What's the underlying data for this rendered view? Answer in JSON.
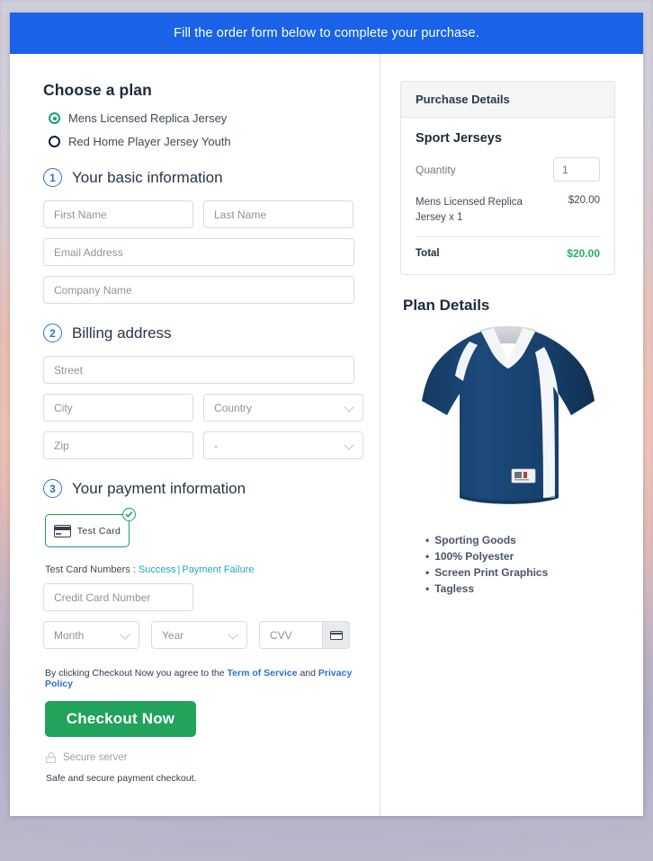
{
  "banner": {
    "text": "Fill the order form below to complete your purchase."
  },
  "plan": {
    "title": "Choose a plan",
    "options": [
      {
        "label": "Mens Licensed Replica Jersey",
        "selected": true
      },
      {
        "label": "Red Home Player Jersey Youth",
        "selected": false
      }
    ]
  },
  "steps": {
    "basic": {
      "number": "1",
      "title": "Your basic information"
    },
    "billing": {
      "number": "2",
      "title": "Billing address"
    },
    "payment": {
      "number": "3",
      "title": "Your payment information"
    }
  },
  "fields": {
    "first_name": "First Name",
    "last_name": "Last Name",
    "email": "Email Address",
    "company": "Company Name",
    "street": "Street",
    "city": "City",
    "country": "Country",
    "zip": "Zip",
    "state": "-",
    "credit_card": "Credit Card Number",
    "month": "Month",
    "year": "Year",
    "cvv": "CVV"
  },
  "payment": {
    "tile_label": "Test Card",
    "test_numbers_prefix": "Test Card Numbers :",
    "success_link": "Success",
    "separator": "|",
    "failure_link": "Payment Failure"
  },
  "footer": {
    "terms_prefix": "By clicking Checkout Now you agree to the",
    "terms_link": "Term of Service",
    "terms_mid": "and",
    "privacy_link": "Privacy Policy",
    "checkout_label": "Checkout Now",
    "secure_server": "Secure server",
    "safe_text": "Safe and secure payment checkout."
  },
  "purchase": {
    "header": "Purchase Details",
    "product_title": "Sport Jerseys",
    "quantity_label": "Quantity",
    "quantity_value": "1",
    "line_item_name": "Mens Licensed Replica Jersey x 1",
    "line_item_price": "$20.00",
    "total_label": "Total",
    "total_value": "$20.00"
  },
  "plan_details": {
    "title": "Plan Details",
    "image_alt": "navy-blue-v-neck-sport-jersey",
    "features": [
      "Sporting Goods",
      "100% Polyester",
      "Screen Print Graphics",
      "Tagless"
    ]
  },
  "colors": {
    "banner_blue": "#1a62e8",
    "step_blue": "#2f6fd0",
    "checkout_green": "#21a35b",
    "total_green": "#23b45f",
    "tile_green": "#19a05e",
    "link_teal": "#23a7b8",
    "radio_teal": "#16a085"
  }
}
